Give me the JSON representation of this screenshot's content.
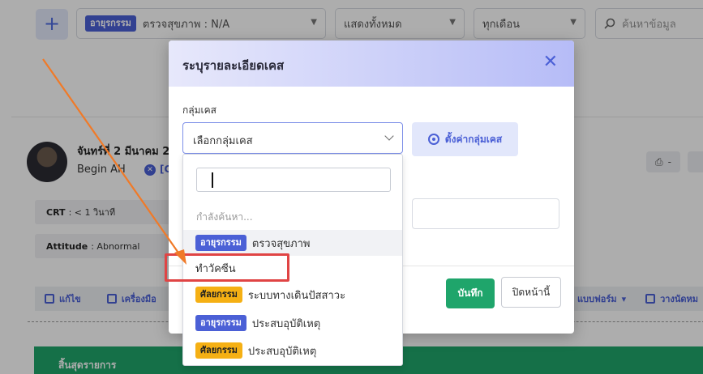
{
  "topbar": {
    "add_label": "+",
    "filter_category": {
      "tag": "อายุรกรรม",
      "label": "ตรวจสุขภาพ : N/A"
    },
    "filter_show": "แสดงทั้งหมด",
    "filter_month": "ทุกเดือน",
    "search_placeholder": "ค้นหาข้อมูล"
  },
  "record": {
    "date": "จันทร์ที่ 2 มีนาคม 2",
    "doctor": "Begin AH",
    "doctor_tail": "[C",
    "crt_label": "CRT",
    "crt_value": ": < 1 วินาที",
    "attitude_label": "Attitude",
    "attitude_value": ": Abnormal",
    "print_dash": "-",
    "toolbar": {
      "edit": "แก้ไข",
      "tools": "เครื่องมือ",
      "forms": "แบบฟอร์ม",
      "schedule": "วางนัดหม"
    },
    "summary": "สิ้นสุดรายการ"
  },
  "modal": {
    "title": "ระบุรายละเอียดเคส",
    "close": "✕",
    "group_label": "กลุ่มเคส",
    "group_placeholder": "เลือกกลุ่มเคส",
    "settings_button": "ตั้งค่ากลุ่มเคส",
    "save_button": "บันทึก",
    "close_page_button": "ปิดหน้านี้"
  },
  "dropdown": {
    "searching_text": "กำลังค้นหา...",
    "items": [
      {
        "tag": "อายุรกรรม",
        "tag_color": "blue",
        "label": "ตรวจสุขภาพ",
        "highlighted": true
      },
      {
        "tag": "",
        "tag_color": "",
        "label": "ทำวัคซีน",
        "highlighted": false
      },
      {
        "tag": "ศัลยกรรม",
        "tag_color": "yellow",
        "label": "ระบบทางเดินปัสสาวะ",
        "highlighted": false
      },
      {
        "tag": "อายุรกรรม",
        "tag_color": "blue",
        "label": "ประสบอุบัติเหตุ",
        "highlighted": false
      },
      {
        "tag": "ศัลยกรรม",
        "tag_color": "yellow",
        "label": "ประสบอุบัติเหตุ",
        "highlighted": false
      }
    ]
  },
  "colors": {
    "primary": "#4b60d6",
    "success": "#1fa56b",
    "warning": "#f5b014",
    "annotation_red": "#e04444",
    "annotation_orange": "#f07a28"
  }
}
